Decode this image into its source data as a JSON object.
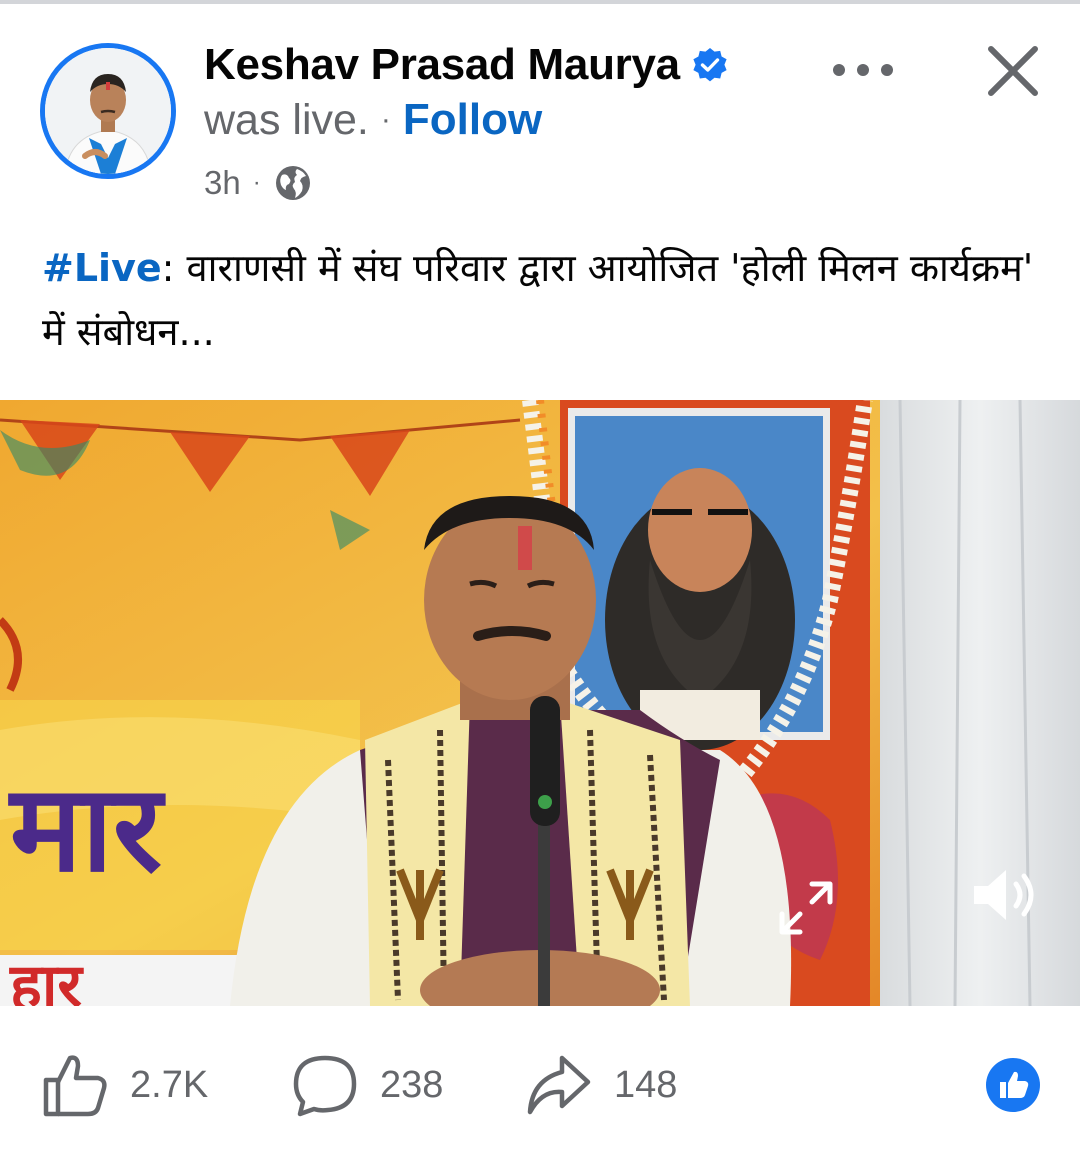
{
  "post": {
    "author_name": "Keshav Prasad Maurya",
    "status_text": "was live.",
    "separator": "·",
    "follow_label": "Follow",
    "time_ago": "3h",
    "meta_separator": "·",
    "audience_icon": "globe-icon",
    "verified_icon": "verified-badge-icon"
  },
  "caption": {
    "hashtag": "#Live",
    "text": ": वाराणसी में संघ परिवार द्वारा आयोजित 'होली मिलन कार्यक्रम' में संबोधन..."
  },
  "video": {
    "controls": {
      "expand_icon": "expand-icon",
      "volume_icon": "volume-icon"
    }
  },
  "engagement": {
    "likes": "2.7K",
    "comments": "238",
    "shares": "148"
  },
  "colors": {
    "accent": "#1877f2",
    "link": "#0a66c2",
    "secondary_text": "#65676b"
  }
}
